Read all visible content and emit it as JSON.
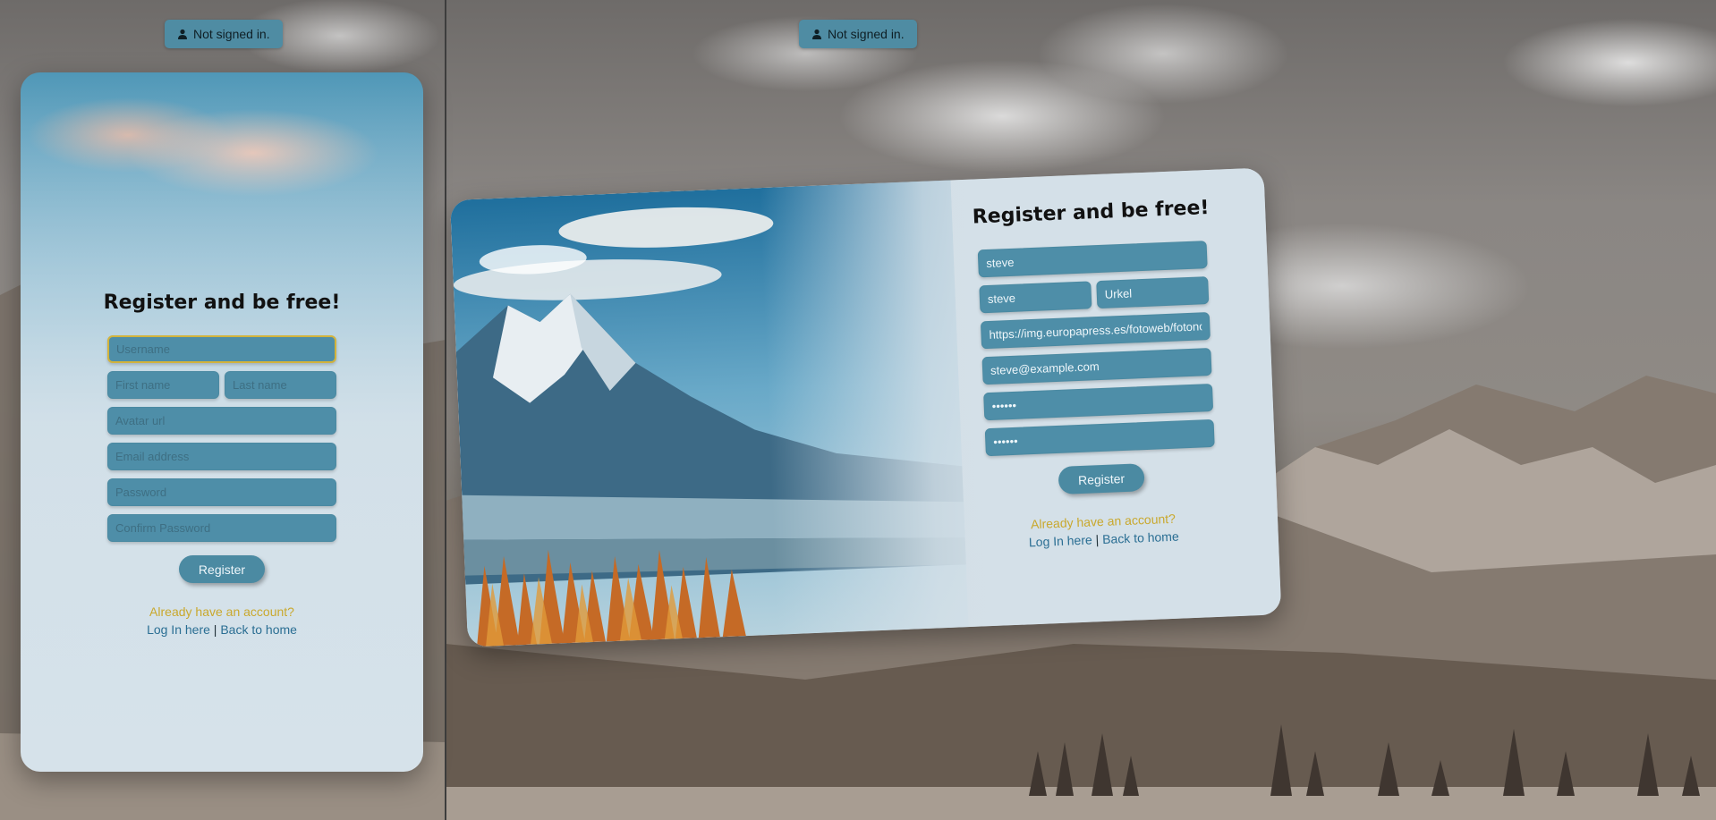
{
  "status": {
    "label": "Not signed in.",
    "icon": "user-icon"
  },
  "form": {
    "title": "Register and be free!",
    "username_placeholder": "Username",
    "first_name_placeholder": "First name",
    "last_name_placeholder": "Last name",
    "avatar_placeholder": "Avatar url",
    "email_placeholder": "Email address",
    "password_placeholder": "Password",
    "confirm_placeholder": "Confirm Password",
    "register_label": "Register",
    "already_text": "Already have an account?",
    "login_link": "Log In here",
    "separator": "|",
    "home_link": "Back to home"
  },
  "filled": {
    "username": "steve",
    "first_name": "steve",
    "last_name": "Urkel",
    "avatar": "https://img.europapress.es/fotoweb/fotonoticia",
    "email": "steve@example.com",
    "password": "••••••",
    "confirm": "••••••"
  },
  "colors": {
    "accent": "#4e8ea8",
    "link": "#2a6e93",
    "gold": "#c9a82d",
    "focus": "#d2b33c"
  }
}
